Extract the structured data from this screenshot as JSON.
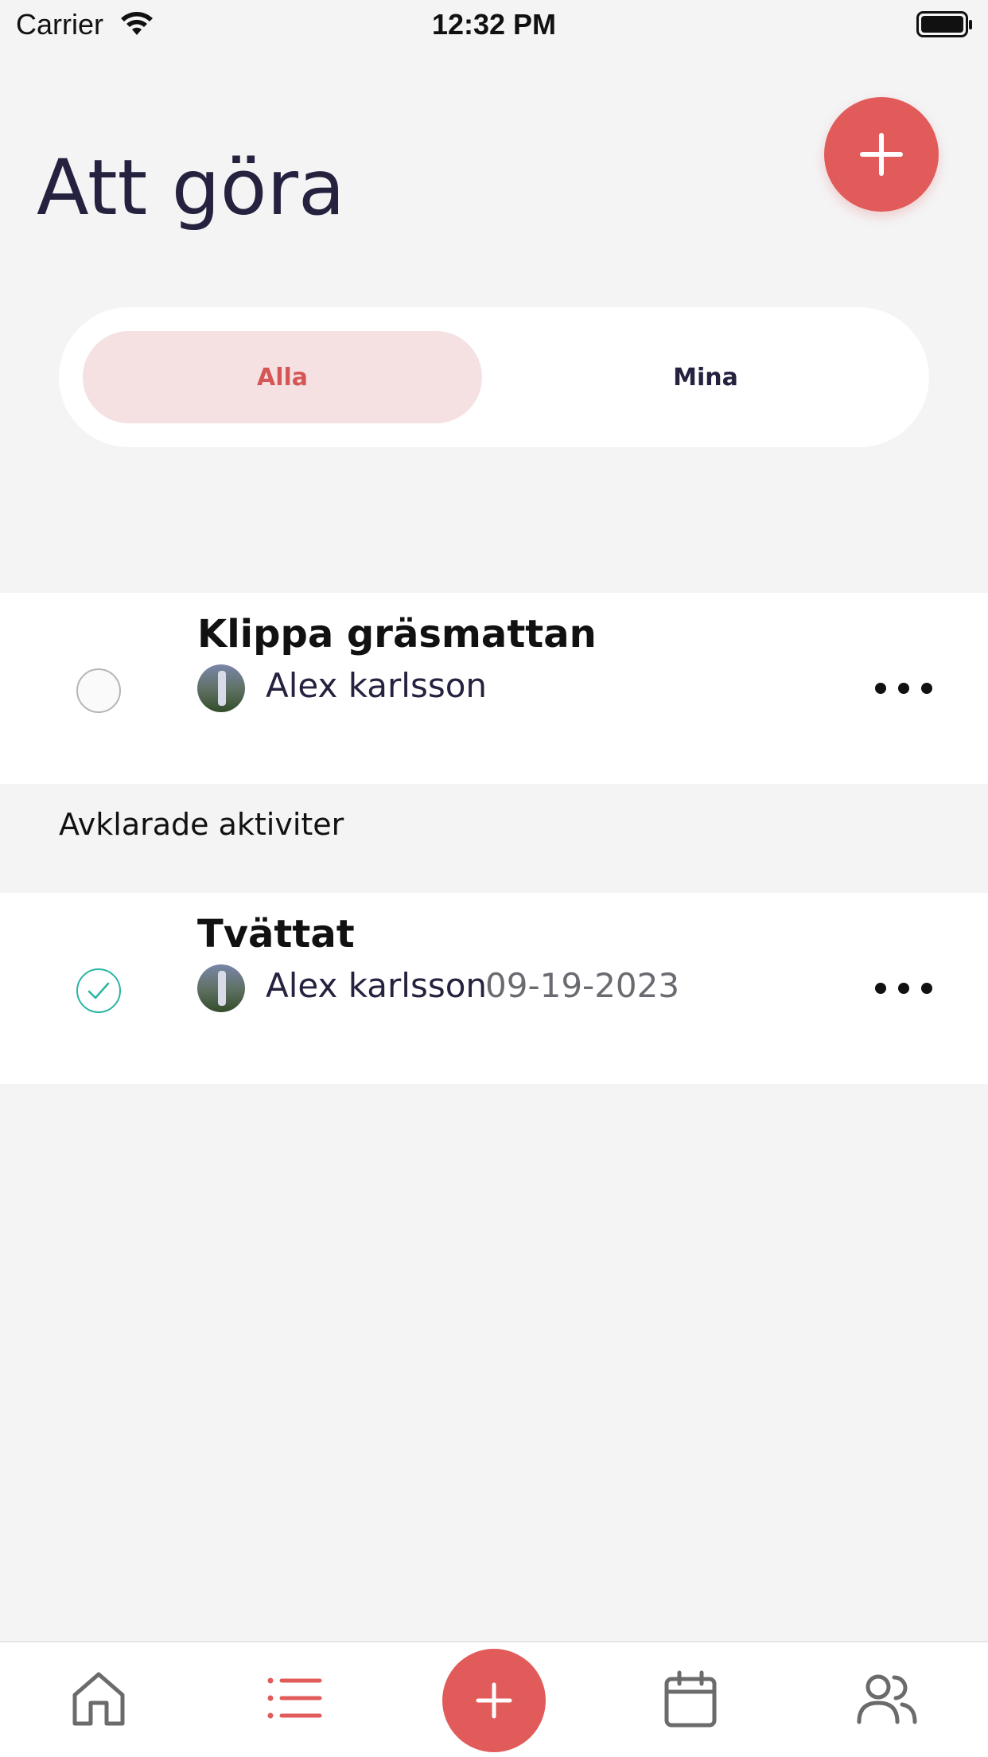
{
  "status_bar": {
    "carrier": "Carrier",
    "time": "12:32 PM"
  },
  "header": {
    "title": "Att göra"
  },
  "filter": {
    "all_label": "Alla",
    "mine_label": "Mina",
    "selected": "Alla"
  },
  "tasks": [
    {
      "title": "Klippa gräsmattan",
      "assignee": "Alex karlsson",
      "completed": false
    }
  ],
  "completed_section": {
    "heading": "Avklarade aktiviter",
    "tasks": [
      {
        "title": "Tvättat",
        "assignee": "Alex karlsson",
        "date": "09-19-2023",
        "completed": true
      }
    ]
  },
  "tab_bar": {
    "items": [
      {
        "icon": "home-icon",
        "active": false
      },
      {
        "icon": "list-icon",
        "active": true
      },
      {
        "icon": "plus-icon",
        "active": false
      },
      {
        "icon": "calendar-icon",
        "active": false
      },
      {
        "icon": "people-icon",
        "active": false
      }
    ]
  },
  "colors": {
    "accent": "#e25b5b",
    "accent_soft": "#f5e1e1",
    "text_primary": "#24223f",
    "check_done": "#2bb5a3",
    "background": "#f4f4f5"
  }
}
